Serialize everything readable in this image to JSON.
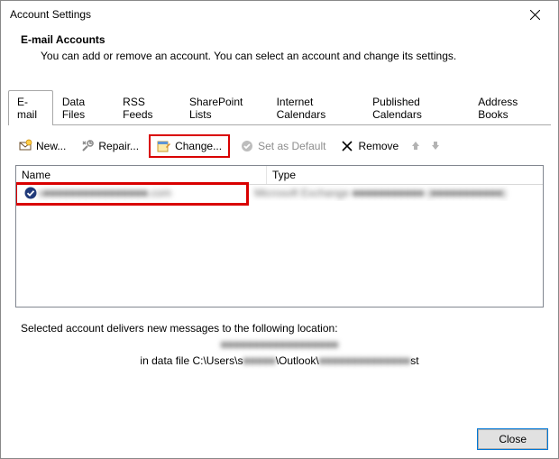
{
  "titlebar": {
    "title": "Account Settings"
  },
  "heading": {
    "title": "E-mail Accounts",
    "subtitle": "You can add or remove an account. You can select an account and change its settings."
  },
  "tabs": [
    {
      "label": "E-mail"
    },
    {
      "label": "Data Files"
    },
    {
      "label": "RSS Feeds"
    },
    {
      "label": "SharePoint Lists"
    },
    {
      "label": "Internet Calendars"
    },
    {
      "label": "Published Calendars"
    },
    {
      "label": "Address Books"
    }
  ],
  "toolbar": {
    "new": "New...",
    "repair": "Repair...",
    "change": "Change...",
    "set_default": "Set as Default",
    "remove": "Remove"
  },
  "columns": {
    "name": "Name",
    "type": "Type"
  },
  "rows": [
    {
      "name": "s■■■■■■■■■■■■■■■■.com",
      "type": "Microsoft Exchange ■■■■■■■■■■■ (■■■■■■■■■■■)"
    }
  ],
  "delivery": {
    "intro": "Selected account delivers new messages to the following location:",
    "account": "■■■■■■■■■■■■■■■■■■",
    "prefix": "in data file C:\\Users\\s",
    "mid": "■■■■■",
    "outlook": "\\Outlook\\",
    "mid2": "■■■■■■■■■■■■■■",
    "suffix": "st"
  },
  "footer": {
    "close": "Close"
  }
}
